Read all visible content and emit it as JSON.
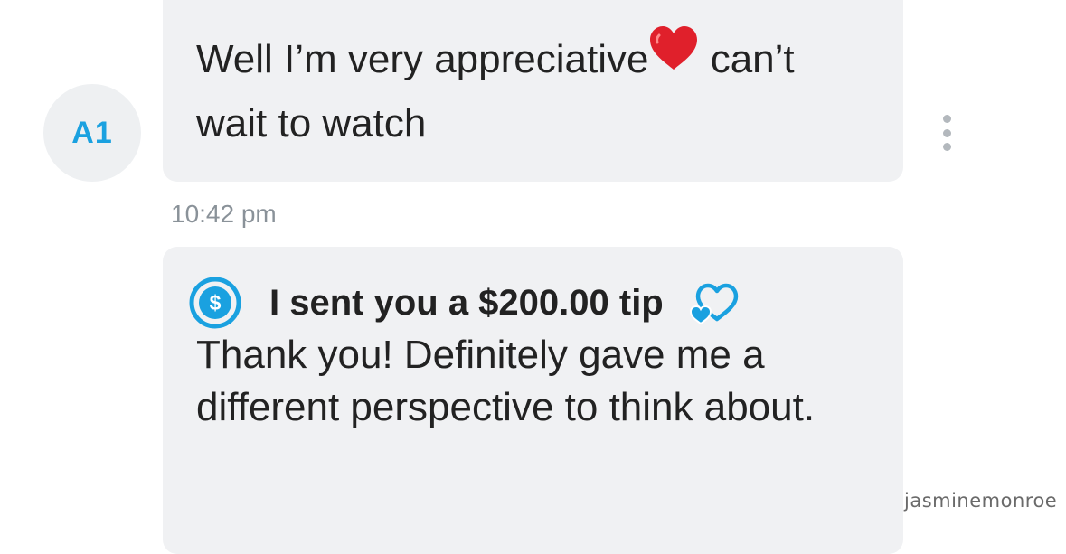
{
  "avatar": {
    "initials": "A1"
  },
  "message1": {
    "text_before_emoji": "Well I’m very appreciative",
    "emoji": "red-heart",
    "text_after_emoji": " can’t wait to watch"
  },
  "timestamp": "10:42 pm",
  "message2": {
    "tip_icon": "dollar-circle-icon",
    "tip_label": "I sent you a $200.00 tip",
    "tip_heart_icon": "hearts-outline-icon",
    "text": "Thank you! Definitely gave me a different perspective to think about."
  },
  "watermark": "jasminemonroe",
  "colors": {
    "accent": "#1aa1e0",
    "bubble": "#f0f1f3",
    "avatar_bg": "#eef0f2",
    "timestamp": "#8a9299"
  }
}
